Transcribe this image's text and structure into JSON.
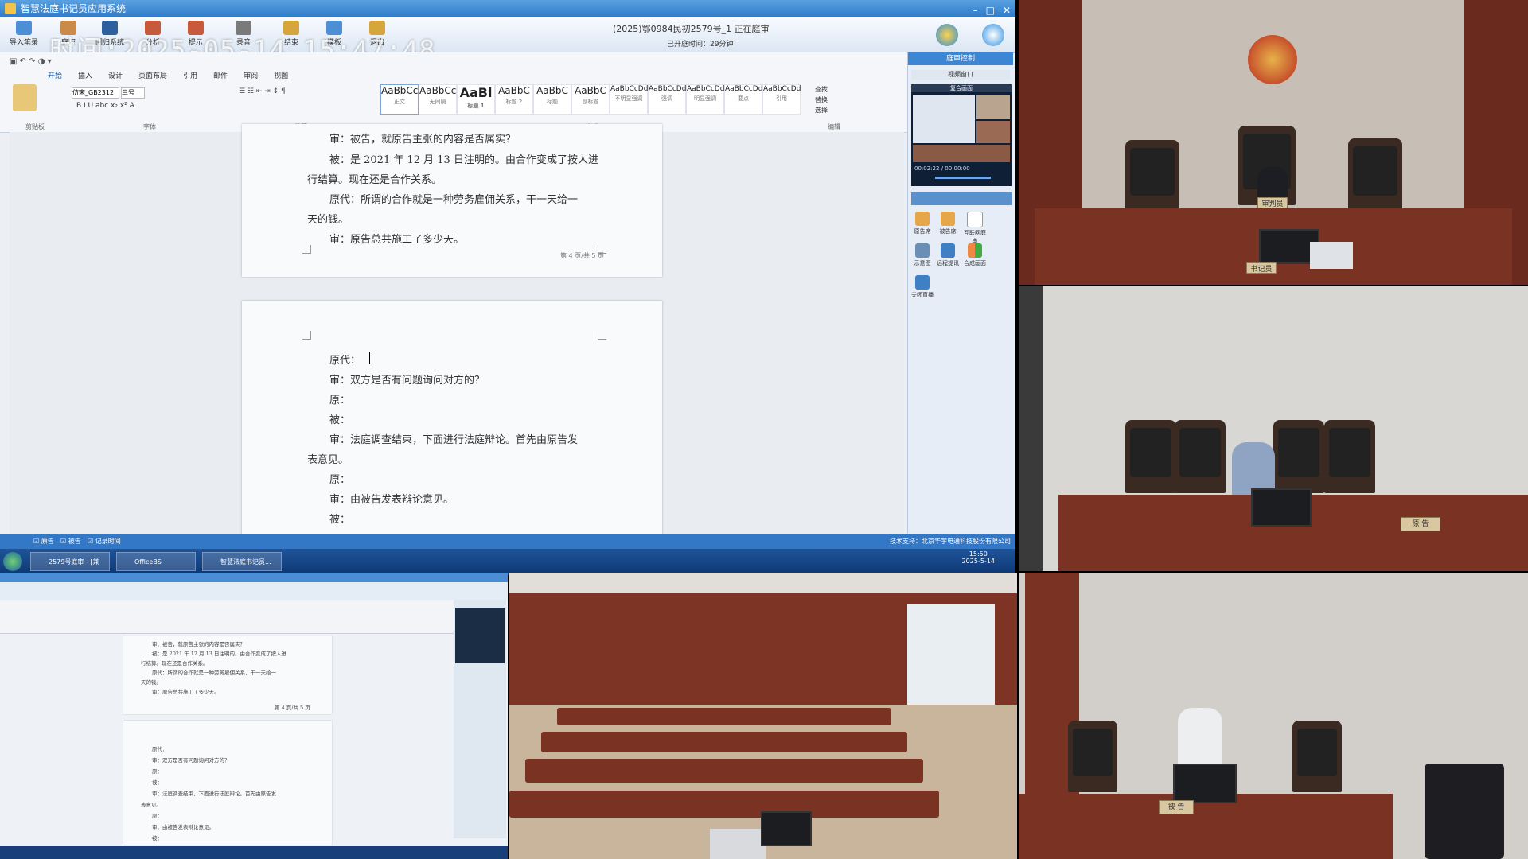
{
  "app": {
    "title": "智慧法庭书记员应用系统",
    "timestamp_overlay": "时间:2025-05-14 15:47:48",
    "case_number": "(2025)鄂0984民初2579号_1  正在庭审",
    "elapsed": "已开庭时间：29分钟"
  },
  "toolbar": [
    {
      "label": "导入笔录"
    },
    {
      "label": "庭审"
    },
    {
      "label": "回归系统"
    },
    {
      "label": "分析"
    },
    {
      "label": "提示"
    },
    {
      "label": "录音"
    },
    {
      "label": "结束"
    },
    {
      "label": "模板"
    },
    {
      "label": "退出"
    }
  ],
  "ribbon": {
    "tabs": [
      "开始",
      "插入",
      "设计",
      "页面布局",
      "引用",
      "邮件",
      "审阅",
      "视图"
    ],
    "font_name": "仿宋_GB2312",
    "font_size": "三号",
    "styles": [
      {
        "preview": "AaBbCcDd",
        "name": "正文"
      },
      {
        "preview": "AaBbCcDd",
        "name": "无间隔"
      },
      {
        "preview": "AaBl",
        "name": "标题 1"
      },
      {
        "preview": "AaBbC",
        "name": "标题 2"
      },
      {
        "preview": "AaBbC",
        "name": "标题"
      },
      {
        "preview": "AaBbC",
        "name": "副标题"
      },
      {
        "preview": "AaBbCcDd",
        "name": "不明显强调"
      },
      {
        "preview": "AaBbCcDd",
        "name": "强调"
      },
      {
        "preview": "AaBbCcDd",
        "name": "明显强调"
      },
      {
        "preview": "AaBbCcDd",
        "name": "要点"
      },
      {
        "preview": "AaBbCcDd",
        "name": "引用"
      }
    ],
    "groups": [
      "剪贴板",
      "字体",
      "段落",
      "样式",
      "编辑"
    ],
    "edit": [
      "查找",
      "替换",
      "选择"
    ]
  },
  "document": {
    "page1_lines": [
      "审：被告，就原告主张的内容是否属实？",
      "被：是 2021 年 12 月 13 日注明的。由合作变成了按人进",
      "行结算。现在还是合作关系。",
      "原代：所谓的合作就是一种劳务雇佣关系，干一天给一",
      "天的钱。",
      "审：原告总共施工了多少天。"
    ],
    "page1_footer": "第 4 页/共 5 页",
    "page2_lines": [
      "原代：",
      "审：双方是否有问题询问对方的？",
      "原：",
      "被：",
      "审：法庭调查结束，下面进行法庭辩论。首先由原告发",
      "表意见。",
      "原：",
      "审：由被告发表辩论意见。",
      "被："
    ]
  },
  "side_panel": {
    "header": "庭审控制",
    "video_window": "视频窗口",
    "video_mode": "复合画面",
    "video_time": "00:02:22 / 00:00:00",
    "icons": [
      {
        "label": "原告席"
      },
      {
        "label": "被告席"
      },
      {
        "label": "互联网庭审"
      },
      {
        "label": "示意图"
      },
      {
        "label": "远程提讯"
      },
      {
        "label": "合成画面"
      },
      {
        "label": "关闭直播"
      }
    ]
  },
  "statusbar": {
    "checks": [
      "原告",
      "被告",
      "记录时间"
    ],
    "right": "技术支持：北京华宇电通科技股份有限公司"
  },
  "taskbar": {
    "items": [
      "2579号庭审 - [兼容...",
      "OfficeBS",
      "智慧法庭书记员..."
    ],
    "time": "15:50",
    "date": "2025-5-14"
  },
  "cameras": {
    "judge": {
      "nameplate": "审判员",
      "clerk_plate": "书记员"
    },
    "plaintiff": {
      "nameplate": "原 告"
    },
    "defendant": {
      "nameplate": "被 告"
    }
  },
  "colors": {
    "title_blue": "#2f7bc8",
    "wood": "#7a3322",
    "taskbar": "#0e3672"
  }
}
